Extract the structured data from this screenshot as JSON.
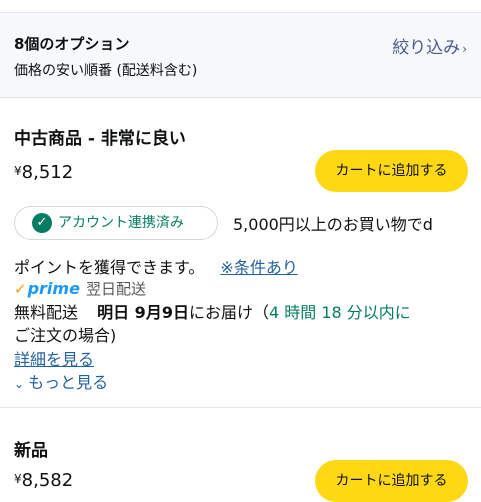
{
  "options": {
    "count_label": "8個のオプション",
    "sort_label": "価格の安い順番 (配送料含む)",
    "filter_label": "絞り込み",
    "filter_chevron": "›"
  },
  "offers": [
    {
      "condition": "中古商品 - 非常に良い",
      "price_currency": "¥",
      "price_value": "8,512",
      "cart_label": "カートに追加する",
      "account_badge": "アカウント連携済み",
      "points_text_a": "5,000円以上のお買い物でd",
      "points_text_b": "ポイントを獲得できます。",
      "conditions_link": "※条件あり",
      "prime_label": "prime",
      "prime_delivery": "翌日配送",
      "shipping_prefix": "無料配送",
      "delivery_date": "明日 9月9日",
      "delivery_suffix": "にお届け（",
      "countdown": "4 時間 18 分",
      "countdown_suffix": "以内に",
      "order_case": "ご注文の場合)",
      "details_link": "詳細を見る",
      "more_link": "もっと見る"
    },
    {
      "condition": "新品",
      "price_currency": "¥",
      "price_value": "8,582",
      "cart_label": "カートに追加する"
    }
  ],
  "colors": {
    "cart_button": "#ffd814",
    "link": "#2162a1",
    "success_green": "#067d62",
    "prime_blue": "#1a98ff"
  }
}
